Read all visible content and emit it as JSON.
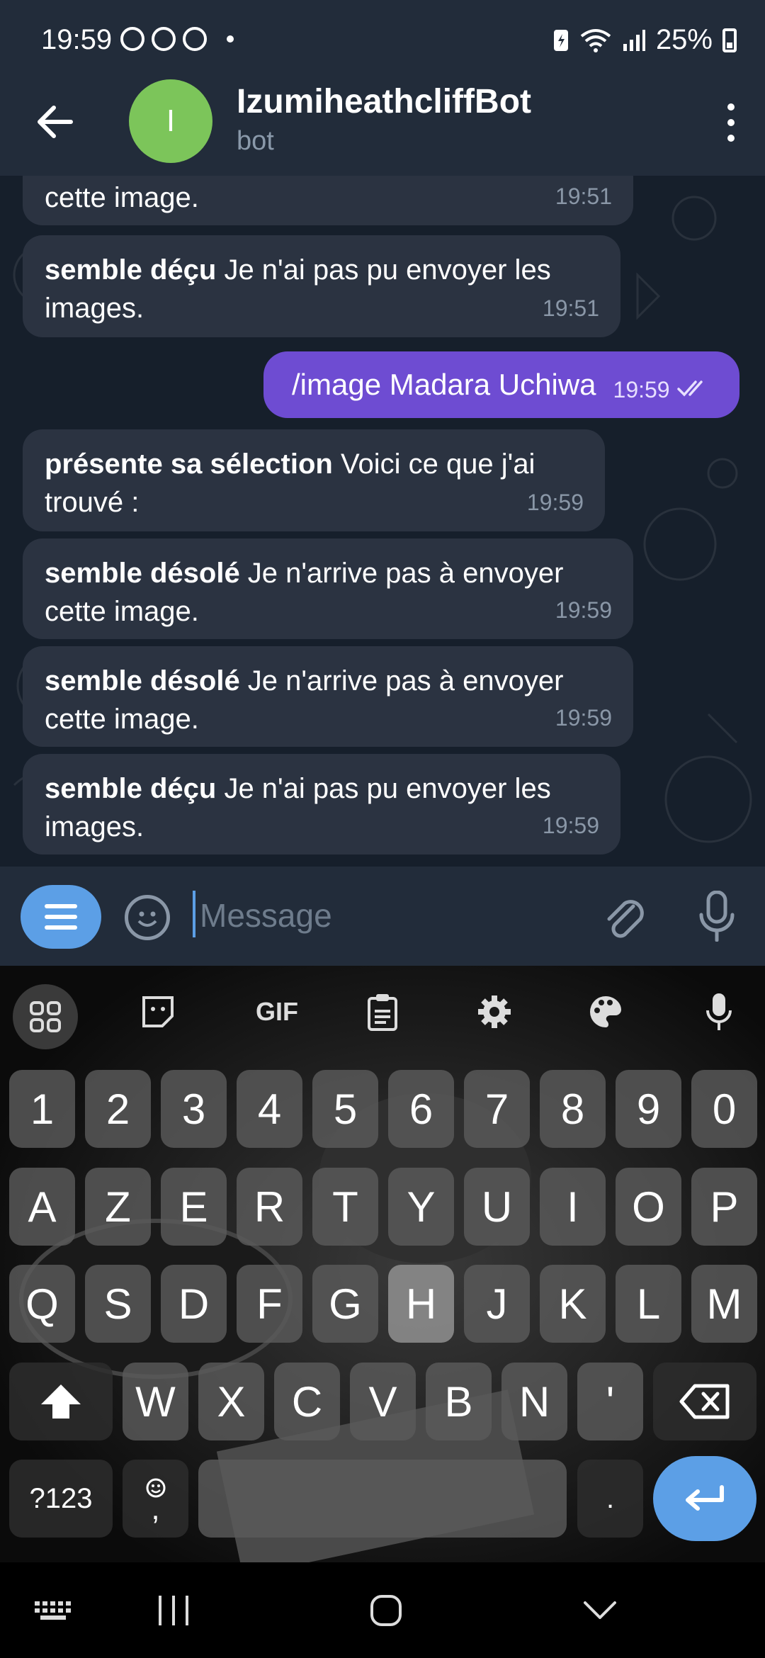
{
  "status_bar": {
    "time": "19:59",
    "battery": "25%"
  },
  "header": {
    "avatar_letter": "I",
    "title": "IzumiheathcliffBot",
    "subtitle": "bot"
  },
  "messages": [
    {
      "bold": "",
      "text": "cette image.",
      "time": "19:51"
    },
    {
      "bold": "semble déçu",
      "text": " Je n'ai pas pu envoyer les images.",
      "time": "19:51"
    },
    {
      "bold": "",
      "text": "/image Madara Uchiwa",
      "time": "19:59",
      "outgoing": true
    },
    {
      "bold": "présente sa sélection",
      "text": " Voici ce que j'ai trouvé :",
      "time": "19:59"
    },
    {
      "bold": "semble désolé",
      "text": " Je n'arrive pas à envoyer cette image.",
      "time": "19:59"
    },
    {
      "bold": "semble désolé",
      "text": " Je n'arrive pas à envoyer cette image.",
      "time": "19:59"
    },
    {
      "bold": "semble déçu",
      "text": " Je n'ai pas pu envoyer les images.",
      "time": "19:59"
    }
  ],
  "input": {
    "placeholder": "Message"
  },
  "keyboard": {
    "toolbar_gif": "GIF",
    "row_numbers": [
      "1",
      "2",
      "3",
      "4",
      "5",
      "6",
      "7",
      "8",
      "9",
      "0"
    ],
    "row1": [
      "A",
      "Z",
      "E",
      "R",
      "T",
      "Y",
      "U",
      "I",
      "O",
      "P"
    ],
    "row2": [
      "Q",
      "S",
      "D",
      "F",
      "G",
      "H",
      "J",
      "K",
      "L",
      "M"
    ],
    "row3": [
      "W",
      "X",
      "C",
      "V",
      "B",
      "N",
      "'"
    ],
    "symbols_key": "?123",
    "comma": ",",
    "period": "."
  },
  "colors": {
    "header_bg": "#222c3a",
    "chat_bg": "#161f2b",
    "incoming_bubble": "#2b3341",
    "outgoing_bubble": "#6e4cd2",
    "accent": "#5c9fe6"
  }
}
